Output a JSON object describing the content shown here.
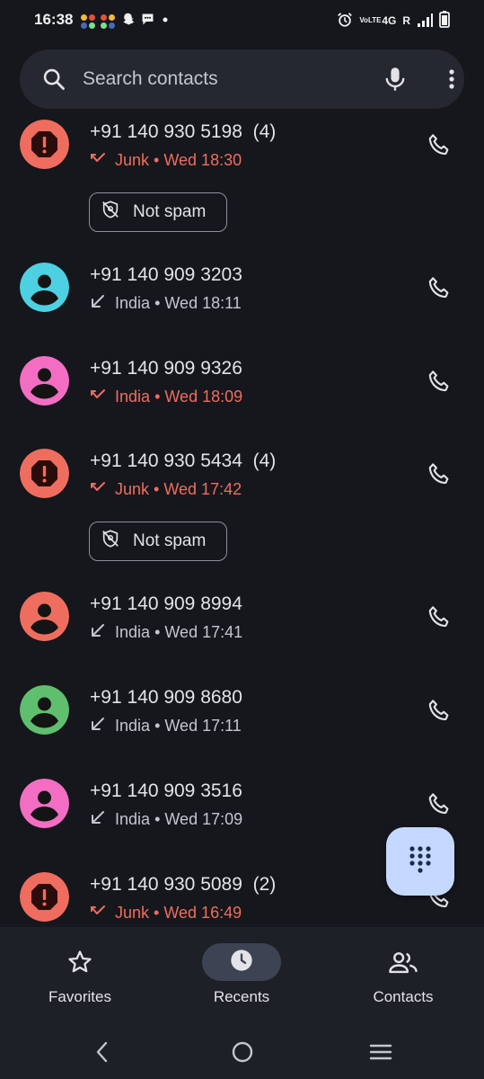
{
  "status_bar": {
    "time": "16:38",
    "app_icons": [
      "pinwheel-app-icon",
      "pinwheel-app-icon",
      "snapchat-icon",
      "chat-bubble-icon",
      "dot-icon"
    ],
    "network": "4G",
    "roaming": "R",
    "volte": "VoLTE",
    "icons": [
      "alarm-icon",
      "volte-icon",
      "signal-icon",
      "battery-icon"
    ]
  },
  "search": {
    "placeholder": "Search contacts",
    "icons": [
      "search-icon",
      "mic-icon",
      "more-vert-icon"
    ]
  },
  "calls": [
    {
      "number": "+91 140 930 5198",
      "count": "(4)",
      "type": "junk",
      "label": "Junk",
      "time": "Wed 18:30",
      "direction": "missed",
      "avatar": "spam-icon",
      "avatar_color": "#ef6d5e",
      "not_spam": "Not spam"
    },
    {
      "number": "+91 140 909 3203",
      "count": "",
      "type": "normal",
      "label": "India",
      "time": "Wed 18:11",
      "direction": "incoming",
      "avatar": "person-icon",
      "avatar_color": "#4dd0e1"
    },
    {
      "number": "+91 140 909 9326",
      "count": "",
      "type": "junk",
      "label": "India",
      "time": "Wed 18:09",
      "direction": "missed",
      "avatar": "person-icon",
      "avatar_color": "#f36ec3"
    },
    {
      "number": "+91 140 930 5434",
      "count": "(4)",
      "type": "junk",
      "label": "Junk",
      "time": "Wed 17:42",
      "direction": "missed",
      "avatar": "spam-icon",
      "avatar_color": "#ef6d5e",
      "not_spam": "Not spam"
    },
    {
      "number": "+91 140 909 8994",
      "count": "",
      "type": "normal",
      "label": "India",
      "time": "Wed 17:41",
      "direction": "incoming",
      "avatar": "person-icon",
      "avatar_color": "#ef6d5e"
    },
    {
      "number": "+91 140 909 8680",
      "count": "",
      "type": "normal",
      "label": "India",
      "time": "Wed 17:11",
      "direction": "incoming",
      "avatar": "person-icon",
      "avatar_color": "#5fbf6e"
    },
    {
      "number": "+91 140 909 3516",
      "count": "",
      "type": "normal",
      "label": "India",
      "time": "Wed 17:09",
      "direction": "incoming",
      "avatar": "person-icon",
      "avatar_color": "#f36ec3"
    },
    {
      "number": "+91 140 930 5089",
      "count": "(2)",
      "type": "junk",
      "label": "Junk",
      "time": "Wed 16:49",
      "direction": "missed",
      "avatar": "spam-icon",
      "avatar_color": "#ef6d5e"
    }
  ],
  "separator": "•",
  "fab": {
    "icon": "dialpad-icon"
  },
  "bottom_nav": {
    "items": [
      {
        "label": "Favorites",
        "icon": "star-icon"
      },
      {
        "label": "Recents",
        "icon": "clock-icon",
        "active": true
      },
      {
        "label": "Contacts",
        "icon": "people-icon"
      }
    ]
  },
  "system_nav": {
    "icons": [
      "back-icon",
      "home-icon",
      "recents-icon"
    ]
  },
  "colors": {
    "background": "#15171c",
    "junk_red": "#ef6d5e",
    "fab": "#c5d8ff",
    "active_pill": "#3d4352"
  }
}
